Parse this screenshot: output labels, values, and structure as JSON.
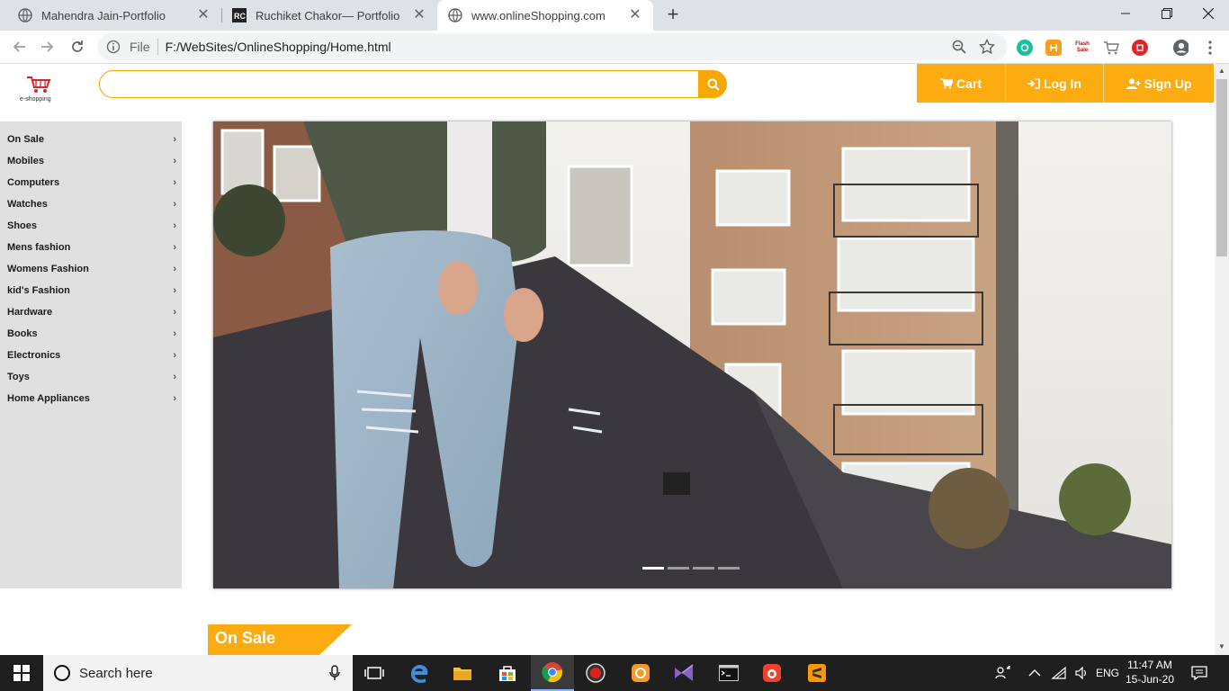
{
  "browser": {
    "tabs": [
      {
        "title": "Mahendra Jain-Portfolio",
        "active": false
      },
      {
        "title": "Ruchiket Chakor— Portfolio",
        "active": false
      },
      {
        "title": "www.onlineShopping.com",
        "active": true
      }
    ],
    "address": {
      "scheme_label": "File",
      "url": "F:/WebSites/OnlineShopping/Home.html"
    },
    "extensions": [
      "grammarly-icon",
      "honey-icon",
      "flash-sale-icon",
      "cart-ext-icon",
      "ext-red-icon"
    ],
    "flash_sale_text": "Flash Sale"
  },
  "site": {
    "logo_caption": "e-shopping",
    "search": {
      "placeholder": "",
      "value": ""
    },
    "header_buttons": {
      "cart": "Cart",
      "login": "Log In",
      "signup": "Sign Up"
    },
    "categories": [
      "On Sale",
      "Mobiles",
      "Computers",
      "Watches",
      "Shoes",
      "Mens fashion",
      "Womens Fashion",
      "kid's Fashion",
      "Hardware",
      "Books",
      "Electronics",
      "Toys",
      "Home Appliances"
    ],
    "carousel": {
      "slide_count": 4,
      "active_index": 0
    },
    "section_title": "On Sale",
    "accent_color": "#fcac10"
  },
  "taskbar": {
    "search_placeholder": "Search here",
    "language": "ENG",
    "time": "11:47 AM",
    "date": "15-Jun-20"
  }
}
